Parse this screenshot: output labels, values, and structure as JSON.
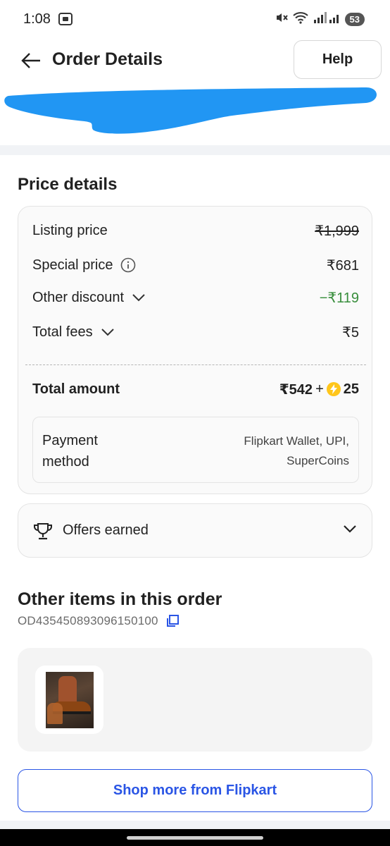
{
  "status_bar": {
    "time": "1:08",
    "battery": "53"
  },
  "header": {
    "title": "Order Details",
    "help_label": "Help"
  },
  "price_details": {
    "heading": "Price details",
    "listing_price": {
      "label": "Listing price",
      "value": "₹1,999"
    },
    "special_price": {
      "label": "Special price",
      "value": "₹681"
    },
    "other_discount": {
      "label": "Other discount",
      "value": "−₹119"
    },
    "total_fees": {
      "label": "Total fees",
      "value": "₹5"
    },
    "total_amount": {
      "label": "Total amount",
      "value": "₹542",
      "plus": "+",
      "coins": "25"
    },
    "payment": {
      "label_line1": "Payment",
      "label_line2": "method",
      "value_line1": "Flipkart Wallet, UPI,",
      "value_line2": "SuperCoins"
    },
    "discount_color": "#388e3c"
  },
  "offers": {
    "label": "Offers earned"
  },
  "other_items": {
    "heading": "Other items in this order",
    "order_id": "OD435450893096150100"
  },
  "shop_more": {
    "label": "Shop more from Flipkart"
  },
  "colors": {
    "accent_blue": "#2a55e5",
    "coin_yellow": "#ffc61b"
  }
}
